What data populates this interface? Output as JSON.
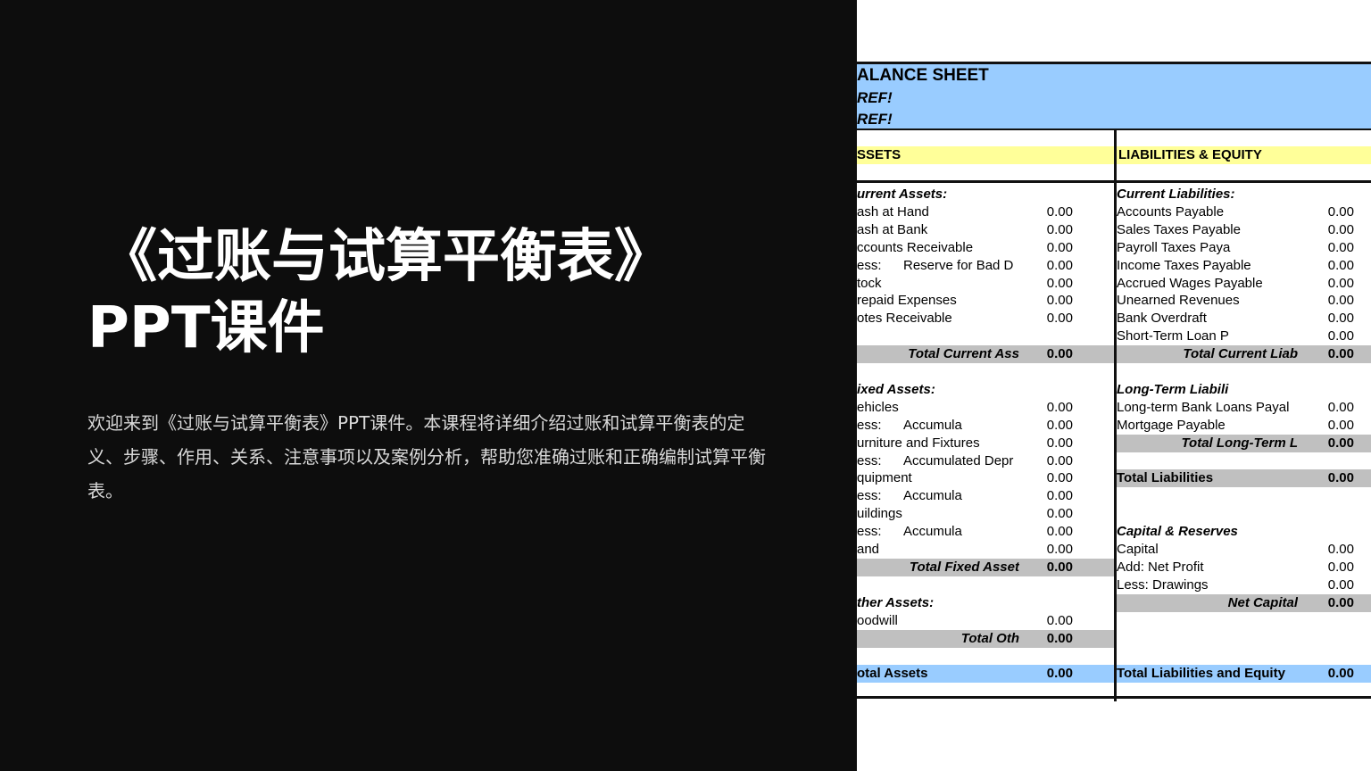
{
  "slide": {
    "title_line1": "《过账与试算平衡表》",
    "title_line2": "PPT课件",
    "description": "欢迎来到《过账与试算平衡表》PPT课件。本课程将详细介绍过账和试算平衡表的定义、步骤、作用、关系、注意事项以及案例分析，帮助您准确过账和正确编制试算平衡表。"
  },
  "sheet": {
    "title": "ALANCE SHEET",
    "ref1": "REF!",
    "ref2": "REF!",
    "assets_header": "SSETS",
    "liabilities_header": "LIABILITIES & EQUITY",
    "assets": [
      {
        "type": "head",
        "label": "urrent Assets:"
      },
      {
        "type": "item",
        "label": "ash at Hand",
        "value": "0.00"
      },
      {
        "type": "item",
        "label": "ash at Bank",
        "value": "0.00"
      },
      {
        "type": "item",
        "label": "ccounts Receivable",
        "value": "0.00"
      },
      {
        "type": "less",
        "prefix": "ess:",
        "label": "Reserve for Bad D",
        "value": "0.00"
      },
      {
        "type": "item",
        "label": "tock",
        "value": "0.00"
      },
      {
        "type": "item",
        "label": "repaid Expenses",
        "value": "0.00"
      },
      {
        "type": "item",
        "label": "otes Receivable",
        "value": "0.00"
      },
      {
        "type": "blank"
      },
      {
        "type": "total",
        "label": "Total Current Ass",
        "value": "0.00"
      },
      {
        "type": "blank"
      },
      {
        "type": "head",
        "label": "ixed Assets:"
      },
      {
        "type": "item",
        "label": "ehicles",
        "value": "0.00"
      },
      {
        "type": "less",
        "prefix": "ess:",
        "label": "Accumula",
        "value": "0.00"
      },
      {
        "type": "item",
        "label": "urniture and Fixtures",
        "value": "0.00"
      },
      {
        "type": "less",
        "prefix": "ess:",
        "label": "Accumulated Depr",
        "value": "0.00"
      },
      {
        "type": "item",
        "label": "quipment",
        "value": "0.00"
      },
      {
        "type": "less",
        "prefix": "ess:",
        "label": "Accumula",
        "value": "0.00"
      },
      {
        "type": "item",
        "label": "uildings",
        "value": "0.00"
      },
      {
        "type": "less",
        "prefix": "ess:",
        "label": "Accumula",
        "value": "0.00"
      },
      {
        "type": "item",
        "label": "and",
        "value": "0.00"
      },
      {
        "type": "total",
        "label": "Total Fixed Asset",
        "value": "0.00"
      },
      {
        "type": "blank"
      },
      {
        "type": "head",
        "label": "ther Assets:"
      },
      {
        "type": "item",
        "label": "oodwill",
        "value": "0.00"
      },
      {
        "type": "total",
        "label": "Total Oth",
        "value": "0.00"
      },
      {
        "type": "blank"
      },
      {
        "type": "gtotal",
        "label": "otal Assets",
        "value": "0.00"
      }
    ],
    "liabilities": [
      {
        "type": "head",
        "label": "Current Liabilities:"
      },
      {
        "type": "item",
        "label": "Accounts Payable",
        "value": "0.00"
      },
      {
        "type": "item",
        "label": "Sales Taxes Payable",
        "value": "0.00"
      },
      {
        "type": "item",
        "label": "Payroll Taxes Paya",
        "value": "0.00"
      },
      {
        "type": "item",
        "label": "Income Taxes Payable",
        "value": "0.00"
      },
      {
        "type": "item",
        "label": "Accrued Wages Payable",
        "value": "0.00"
      },
      {
        "type": "item",
        "label": "Unearned Revenues",
        "value": "0.00"
      },
      {
        "type": "item",
        "label": "Bank Overdraft",
        "value": "0.00"
      },
      {
        "type": "item",
        "label": "Short-Term Loan P",
        "value": "0.00"
      },
      {
        "type": "total",
        "label": "Total Current Liab",
        "value": "0.00"
      },
      {
        "type": "blank"
      },
      {
        "type": "head",
        "label": "Long-Term Liabili"
      },
      {
        "type": "item",
        "label": "Long-term Bank Loans Payal",
        "value": "0.00"
      },
      {
        "type": "item",
        "label": "Mortgage Payable",
        "value": "0.00"
      },
      {
        "type": "total",
        "label": "Total Long-Term L",
        "value": "0.00"
      },
      {
        "type": "blank"
      },
      {
        "type": "tl",
        "label": "Total Liabilities",
        "value": "0.00"
      },
      {
        "type": "blank"
      },
      {
        "type": "blank"
      },
      {
        "type": "head",
        "label": "Capital & Reserves"
      },
      {
        "type": "item",
        "label": "Capital",
        "value": "0.00"
      },
      {
        "type": "item",
        "label": "Add: Net Profit",
        "value": "0.00"
      },
      {
        "type": "item",
        "label": "Less: Drawings",
        "value": "0.00"
      },
      {
        "type": "total",
        "label": "Net Capital",
        "value": "0.00"
      },
      {
        "type": "blank"
      },
      {
        "type": "blank"
      },
      {
        "type": "blank"
      },
      {
        "type": "gtotal",
        "label": "Total Liabilities and Equity",
        "value": "0.00"
      }
    ]
  }
}
